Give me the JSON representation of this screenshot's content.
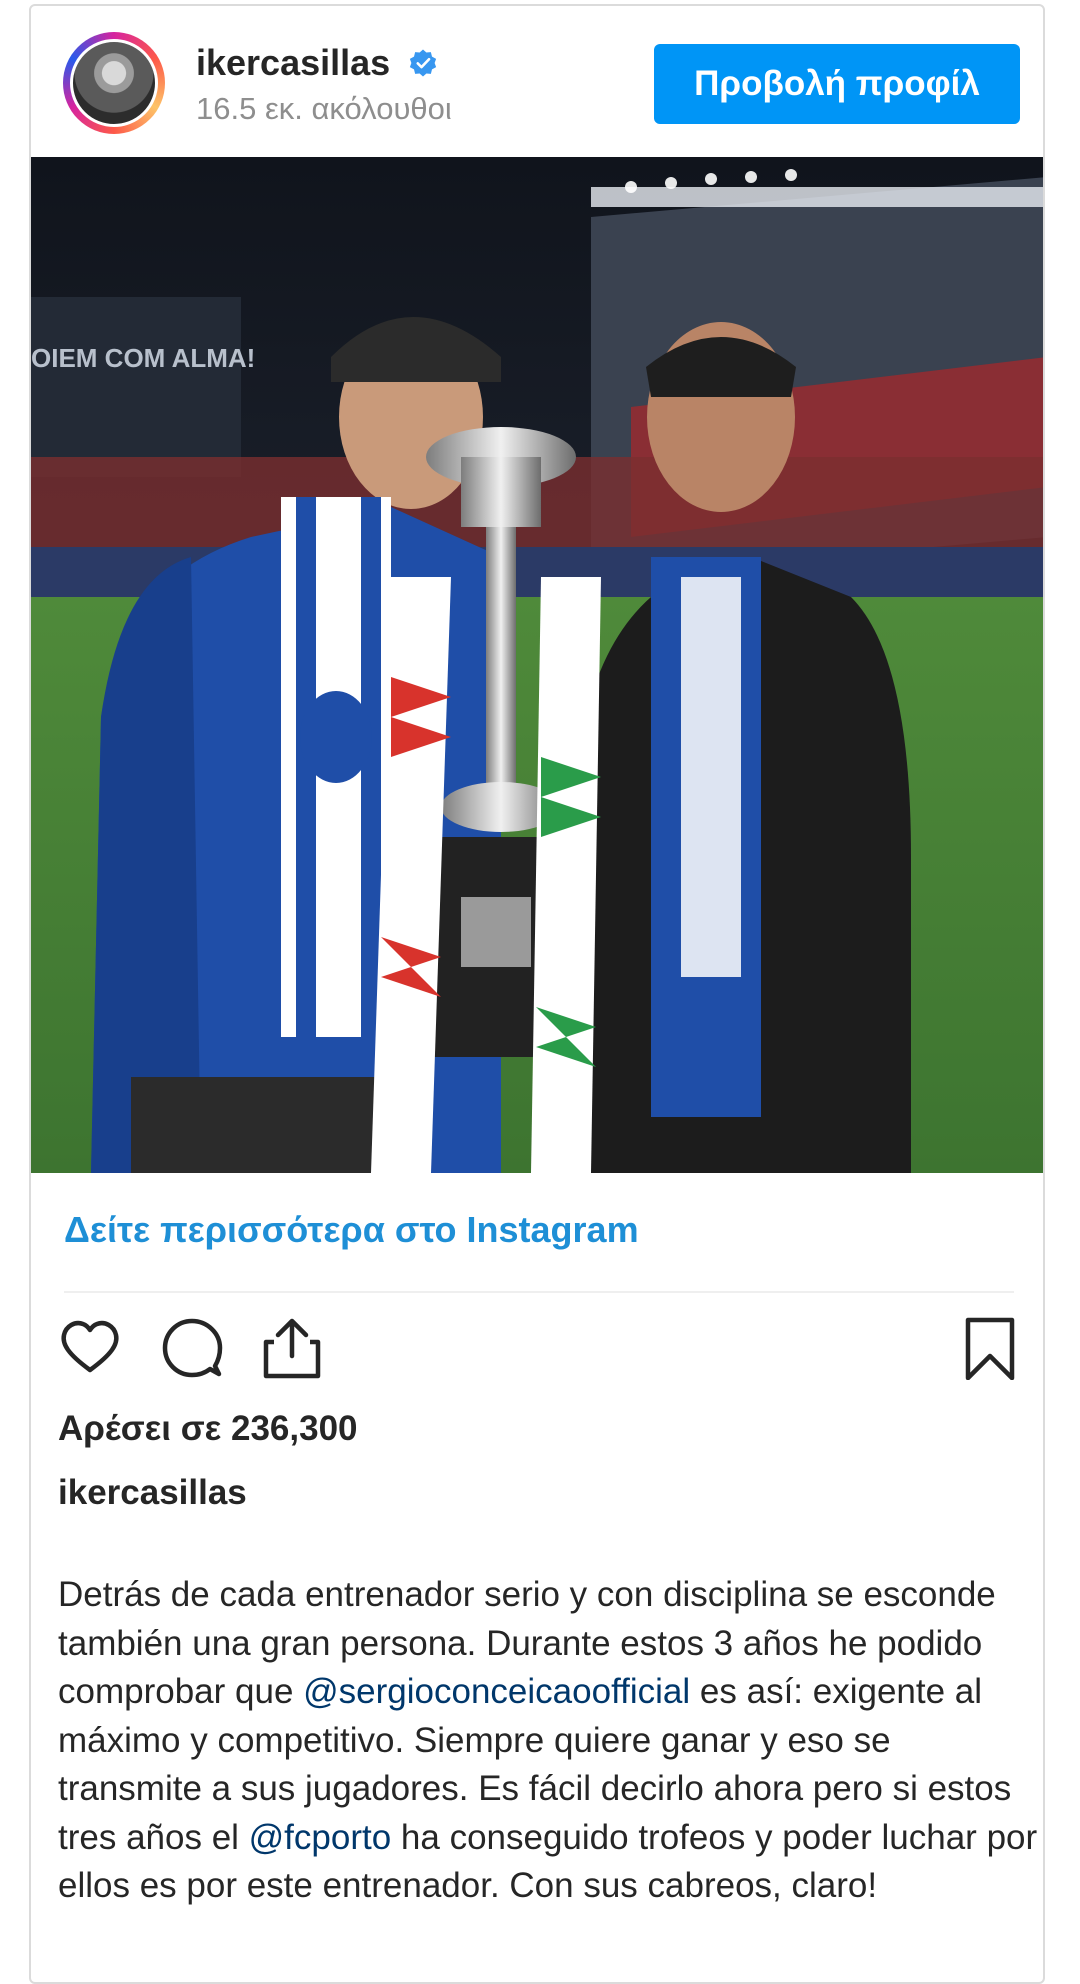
{
  "header": {
    "username": "ikercasillas",
    "followers": "16.5 εκ. ακόλουθοι",
    "view_profile_label": "Προβολή προφίλ"
  },
  "photo": {
    "stadium_banner": "OIEM COM ALMA!",
    "alt": "Post photo"
  },
  "see_more_label": "Δείτε περισσότερα στο Instagram",
  "actions": {
    "like_icon": "heart-icon",
    "comment_icon": "comment-bubble-icon",
    "share_icon": "share-icon",
    "save_icon": "bookmark-icon"
  },
  "likes_label": "Αρέσει σε 236,300",
  "caption": {
    "username": "ikercasillas",
    "part1": "Detrás de cada entrenador serio y con disciplina se esconde también una gran persona. Durante estos 3 años he podido comprobar que ",
    "mention1": "@sergioconceicaoofficial",
    "part2": " es así: exigente al máximo y competitivo. Siempre quiere ganar y eso se transmite a sus jugadores. Es fácil decirlo ahora pero si estos tres años el ",
    "mention2": "@fcporto",
    "part3": " ha conseguido trofeos y poder luchar por ellos es por este entrenador. Con sus cabreos, claro!"
  },
  "colors": {
    "accent_blue": "#0095f6",
    "link_blue": "#1e8fd6",
    "mention_blue": "#00376b",
    "text": "#262626",
    "muted": "#8e8e8e"
  }
}
